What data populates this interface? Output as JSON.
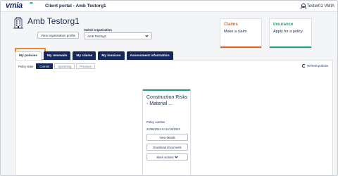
{
  "topbar": {
    "logo": "vmia",
    "title": "Client portal - Amb Testorg1",
    "user_name": "Tester01 VMIA"
  },
  "header": {
    "org_name": "Amb Testorg1",
    "view_profile_label": "View organisation profile",
    "switch_label": "Switch organisation",
    "switch_value": "Amb Testing1"
  },
  "quick_cards": [
    {
      "title": "Claims",
      "subtitle": "Make a claim",
      "title_color": "#e0632a",
      "bar_color": "#e0632a"
    },
    {
      "title": "Insurance",
      "subtitle": "Apply for a policy",
      "title_color": "#1fa37a",
      "bar_color": "#1fa37a"
    }
  ],
  "tabs": [
    {
      "label": "My policies",
      "active": true
    },
    {
      "label": "My renewals",
      "active": false
    },
    {
      "label": "My claims",
      "active": false
    },
    {
      "label": "My invoices",
      "active": false
    },
    {
      "label": "Assessment information",
      "active": false
    }
  ],
  "policy_state": {
    "label": "Policy state",
    "options": [
      {
        "label": "Current",
        "active": true
      },
      {
        "label": "Upcoming",
        "active": false
      },
      {
        "label": "Previous",
        "active": false
      }
    ]
  },
  "refresh_label": "Refresh policies",
  "policy_card": {
    "title": "Construction Risks - Material ...",
    "number_label": "Policy number",
    "dates": "24/06/2024 to 31/10/2024",
    "view_details": "View details",
    "download": "Download documents",
    "more_actions": "More actions"
  },
  "colors": {
    "navy": "#16285a",
    "green": "#1fa37a",
    "orange": "#e0632a",
    "highlight": "#e98a2b"
  }
}
